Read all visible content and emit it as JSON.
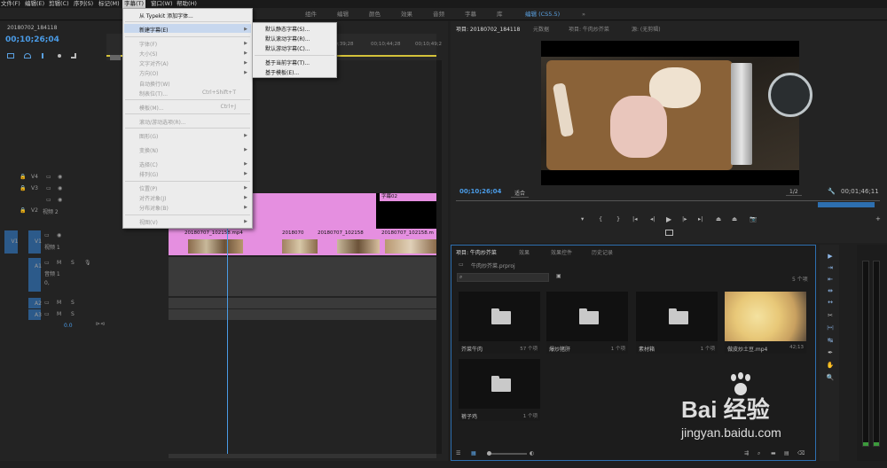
{
  "menubar": {
    "items": [
      "文件(F)",
      "编辑(E)",
      "剪辑(C)",
      "序列(S)",
      "标记(M)",
      "字幕(T)",
      "窗口(W)",
      "帮助(H)"
    ]
  },
  "workspaces": {
    "tabs": [
      "组件",
      "编辑",
      "颜色",
      "效果",
      "音频",
      "字幕",
      "库",
      "编辑 (CS5.5)"
    ],
    "more": "»"
  },
  "timeline": {
    "tab": "20180702_184118",
    "timecode": "00;10;26;04",
    "ruler": [
      "00;10;39;28",
      "00;10;44;28",
      "00;10;49;2"
    ],
    "tracks": [
      "V4",
      "V3",
      "V2",
      "V1",
      "A1",
      "A2",
      "A3"
    ],
    "v2_name": "视频 2",
    "v1_name": "视频 1",
    "a1_name": "音频 1",
    "audio_level": "0.0",
    "master_label": "0,",
    "clip_label": "20180707_102158.mp4",
    "clip_label_short": "2018070",
    "clip_label_mid": "20180707_102158",
    "clip_label_end": "20180707_102158.m",
    "title_clip": "字幕02"
  },
  "title_menu": {
    "items": [
      {
        "label": "从 Typekit 添加字体...",
        "enabled": true
      },
      {
        "label": "新建字幕(E)",
        "enabled": true,
        "submenu": true,
        "highlighted": true
      },
      {
        "label": "字体(F)",
        "enabled": false,
        "submenu": true
      },
      {
        "label": "大小(S)",
        "enabled": false,
        "submenu": true
      },
      {
        "label": "文字对齐(A)",
        "enabled": false,
        "submenu": true
      },
      {
        "label": "方向(O)",
        "enabled": false,
        "submenu": true
      },
      {
        "label": "自动换行(W)",
        "enabled": false
      },
      {
        "label": "制表位(T)...",
        "enabled": false,
        "shortcut": "Ctrl+Shift+T"
      },
      {
        "label": "模板(M)...",
        "enabled": false,
        "shortcut": "Ctrl+J"
      },
      {
        "label": "滚动/游动选项(R)...",
        "enabled": false
      },
      {
        "label": "图形(G)",
        "enabled": false,
        "submenu": true
      },
      {
        "label": "变换(N)",
        "enabled": false,
        "submenu": true
      },
      {
        "label": "选择(C)",
        "enabled": false,
        "submenu": true
      },
      {
        "label": "排列(G)",
        "enabled": false,
        "submenu": true
      },
      {
        "label": "位置(P)",
        "enabled": false,
        "submenu": true
      },
      {
        "label": "对齐对象(J)",
        "enabled": false,
        "submenu": true
      },
      {
        "label": "分布对象(B)",
        "enabled": false,
        "submenu": true
      },
      {
        "label": "视图(V)",
        "enabled": false,
        "submenu": true
      }
    ]
  },
  "new_title_submenu": {
    "items": [
      "默认静态字幕(S)...",
      "默认滚动字幕(R)...",
      "默认游动字幕(C)...",
      "基于当前字幕(T)...",
      "基于模板(E)..."
    ]
  },
  "program_monitor": {
    "tabs": [
      "项目: 20180702_184118",
      "元数据",
      "项目: 牛肉炒芥菜",
      "源: (无剪辑)"
    ],
    "timecode": "00;10;26;04",
    "fit": "适合",
    "resolution": "1/2",
    "duration": "00;01;46;11"
  },
  "project_panel": {
    "tabs": [
      "项目: 牛肉炒芥菜",
      "效果",
      "效果控件",
      "历史记录"
    ],
    "file": "牛肉炒芥菜.prproj",
    "count": "5 个项",
    "items": [
      {
        "name": "芥菜牛肉",
        "count": "57 个项",
        "type": "folder"
      },
      {
        "name": "爆炒猪肝",
        "count": "1 个项",
        "type": "folder"
      },
      {
        "name": "素材箱",
        "count": "1 个项",
        "type": "folder"
      },
      {
        "name": "做皮炒土豆.mp4",
        "count": "42;13",
        "type": "video"
      },
      {
        "name": "裤子鸡",
        "count": "1 个项",
        "type": "folder"
      }
    ]
  },
  "tools": [
    "selection-tool",
    "track-select-tool",
    "ripple-edit-tool",
    "rolling-edit-tool",
    "rate-stretch-tool",
    "razor-tool",
    "slip-tool",
    "slide-tool",
    "pen-tool",
    "hand-tool",
    "zoom-tool"
  ],
  "tool_glyphs": [
    "▶",
    "⇥",
    "⇤",
    "⇹",
    "↔",
    "✂",
    "|↔|",
    "↹",
    "✒",
    "✋",
    "🔍"
  ],
  "watermark": {
    "text": "Bai 经验",
    "url": "jingyan.baidu.com"
  },
  "colors": {
    "accent": "#2d6fb0",
    "timecode": "#4a9be6",
    "clip_pink": "#e58fe0",
    "menu_bg": "#ececec"
  }
}
